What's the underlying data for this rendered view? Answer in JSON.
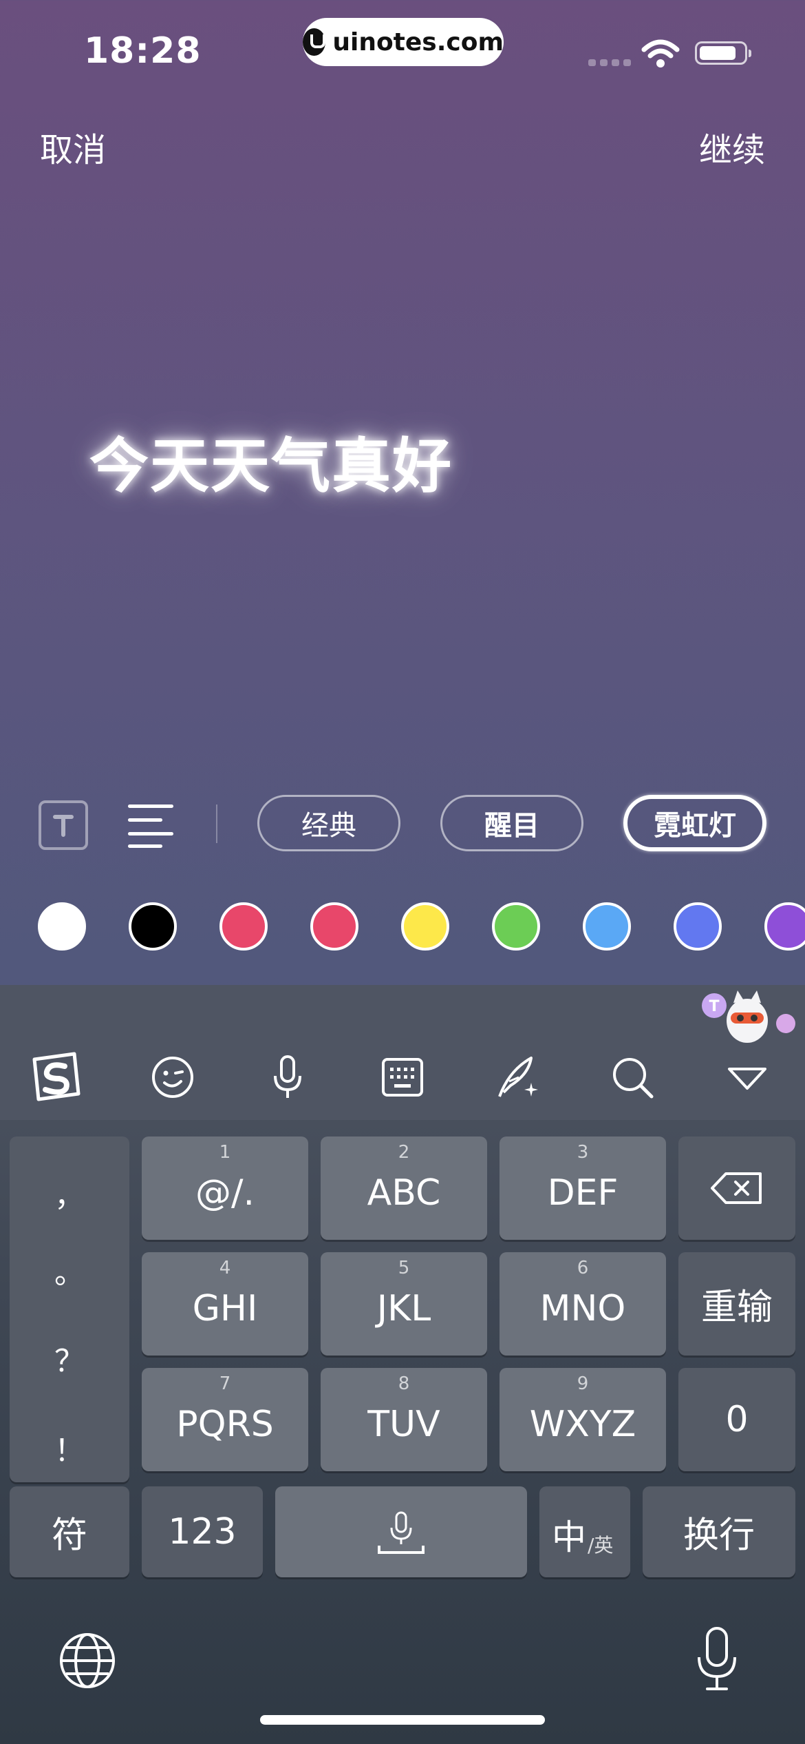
{
  "status_bar": {
    "time": "18:28",
    "watermark": "uinotes.com",
    "icons": [
      "signal-dots-icon",
      "wifi-icon",
      "battery-icon"
    ]
  },
  "nav": {
    "cancel": "取消",
    "continue": "继续"
  },
  "canvas": {
    "text": "今天天气真好"
  },
  "tools": {
    "font_icon": "T",
    "styles": [
      {
        "label": "经典",
        "selected": false
      },
      {
        "label": "醒目",
        "selected": false
      },
      {
        "label": "霓虹灯",
        "selected": true
      }
    ]
  },
  "colors": [
    "#ffffff",
    "#000000",
    "#e8476a",
    "#e8476a",
    "#fde84a",
    "#6ccd55",
    "#5aa8f5",
    "#6278f0",
    "#8e4fd8"
  ],
  "keyboard": {
    "toolbar_icons": [
      "sogou-logo-icon",
      "emoji-icon",
      "voice-icon",
      "keyboard-icon",
      "handwriting-icon",
      "search-icon",
      "collapse-icon"
    ],
    "punctuation": [
      "，",
      "。",
      "？",
      "！"
    ],
    "keys": [
      {
        "num": "1",
        "letters": "@/."
      },
      {
        "num": "2",
        "letters": "ABC"
      },
      {
        "num": "3",
        "letters": "DEF"
      },
      {
        "num": "4",
        "letters": "GHI"
      },
      {
        "num": "5",
        "letters": "JKL"
      },
      {
        "num": "6",
        "letters": "MNO"
      },
      {
        "num": "7",
        "letters": "PQRS"
      },
      {
        "num": "8",
        "letters": "TUV"
      },
      {
        "num": "9",
        "letters": "WXYZ"
      }
    ],
    "reinput": "重输",
    "zero": "0",
    "symbols": "符",
    "numbers": "123",
    "lang_main": "中",
    "lang_sub": "/英",
    "newline": "换行"
  }
}
